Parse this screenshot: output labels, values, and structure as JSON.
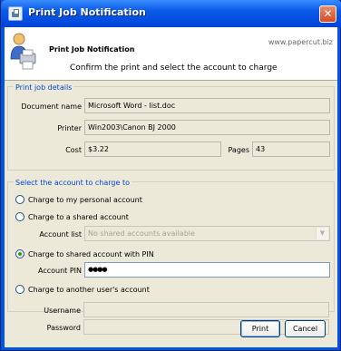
{
  "window": {
    "title": "Print Job Notification",
    "close_glyph": "✕"
  },
  "header": {
    "title": "Print Job Notification",
    "url": "www.papercut.biz",
    "message": "Confirm the print and select the account to charge"
  },
  "print_job_details": {
    "group_title": "Print job details",
    "document_name_label": "Document name",
    "document_name": "Microsoft Word - list.doc",
    "printer_label": "Printer",
    "printer": "Win2003\\Canon BJ 2000",
    "cost_label": "Cost",
    "cost": "$3.22",
    "pages_label": "Pages",
    "pages": "43"
  },
  "account": {
    "group_title": "Select the account to charge to",
    "options": [
      {
        "label": "Charge to my personal account",
        "selected": false
      },
      {
        "label": "Charge to a shared account",
        "selected": false
      },
      {
        "label": "Charge to shared account with PIN",
        "selected": true
      },
      {
        "label": "Charge to another user's account",
        "selected": false
      }
    ],
    "account_list_label": "Account list",
    "account_list_value": "No shared accounts available",
    "account_pin_label": "Account PIN",
    "account_pin_value": "●●●●",
    "username_label": "Username",
    "username_value": "",
    "password_label": "Password",
    "password_value": ""
  },
  "buttons": {
    "print": "Print",
    "cancel": "Cancel"
  },
  "icons": {
    "title": "printer-icon",
    "header": "user-printer-icon",
    "close": "close-icon",
    "dropdown": "chevron-down-icon"
  },
  "colors": {
    "title_bar": "#0a5ae8",
    "group_title": "#0046d5",
    "close": "#d94a22",
    "radio_selected": "#21a121"
  }
}
